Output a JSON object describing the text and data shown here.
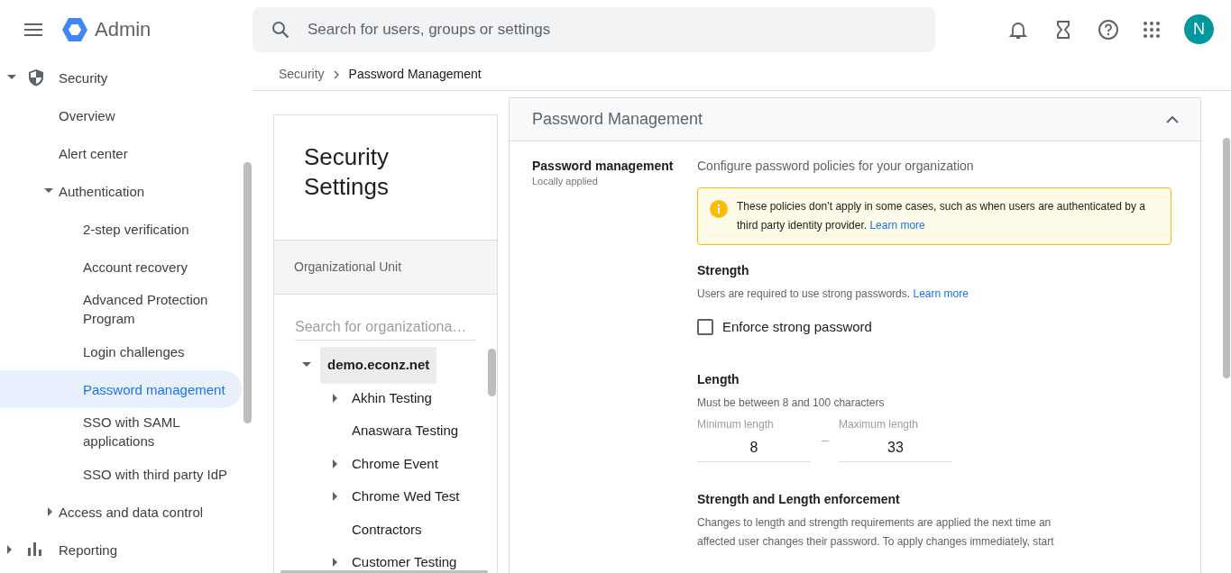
{
  "app": {
    "title": "Admin",
    "search": {
      "placeholder": "Search for users, groups or settings"
    },
    "avatar": "N"
  },
  "sidebar": {
    "items": [
      {
        "label": "Security",
        "expanded": true,
        "selected": false,
        "children": [
          {
            "label": "Overview",
            "selected": false
          },
          {
            "label": "Alert center",
            "selected": false
          },
          {
            "label": "Authentication",
            "expanded": true,
            "selected": false,
            "children": [
              {
                "label": "2-step verification",
                "selected": false
              },
              {
                "label": "Account recovery",
                "selected": false
              },
              {
                "label": "Advanced Protection Program",
                "selected": false
              },
              {
                "label": "Login challenges",
                "selected": false
              },
              {
                "label": "Password management",
                "selected": true
              },
              {
                "label": "SSO with SAML applications",
                "selected": false
              },
              {
                "label": "SSO with third party IdP",
                "selected": false
              }
            ]
          },
          {
            "label": "Access and data control",
            "expanded": false,
            "selected": false
          }
        ]
      },
      {
        "label": "Reporting",
        "expanded": false,
        "selected": false
      }
    ]
  },
  "breadcrumb": [
    "Security",
    "Password Management"
  ],
  "org_panel": {
    "title": "Security Settings",
    "header": "Organizational Unit",
    "search": {
      "placeholder": "Search for organizationa…"
    },
    "tree": [
      {
        "label": "demo.econz.net",
        "expanded": true,
        "selected": true,
        "children": [
          {
            "label": "Akhin Testing",
            "expanded": false,
            "selected": false
          },
          {
            "label": "Anaswara Testing",
            "selected": false
          },
          {
            "label": "Chrome Event",
            "expanded": false,
            "selected": false
          },
          {
            "label": "Chrome Wed Test",
            "expanded": false,
            "selected": false
          },
          {
            "label": "Contractors",
            "selected": false
          },
          {
            "label": "Customer Testing",
            "expanded": false,
            "selected": false
          }
        ]
      }
    ]
  },
  "settings": {
    "title": "Password Management",
    "expanded": true,
    "setting_name": "Password management",
    "applied": "Locally applied",
    "description": "Configure password policies for your organization",
    "notice": {
      "text": "These policies don’t apply in some cases, such as when users are authenticated by a third party identity provider.",
      "link": "Learn more"
    },
    "sections": [
      {
        "kind": "checkbox",
        "title": "Strength",
        "text": "Users are required to use strong passwords.",
        "link": "Learn more",
        "option": {
          "label": "Enforce strong password",
          "checked": false
        }
      },
      {
        "kind": "range",
        "title": "Length",
        "text": "Must be between 8 and 100 characters",
        "fields": [
          {
            "label": "Minimum length",
            "value": "8"
          },
          {
            "label": "Maximum length",
            "value": "33"
          }
        ],
        "separator": "–"
      },
      {
        "kind": "text",
        "title": "Strength and Length enforcement",
        "text": "Changes to length and strength requirements are applied the next time an affected user changes their password. To apply changes immediately, start"
      }
    ]
  }
}
